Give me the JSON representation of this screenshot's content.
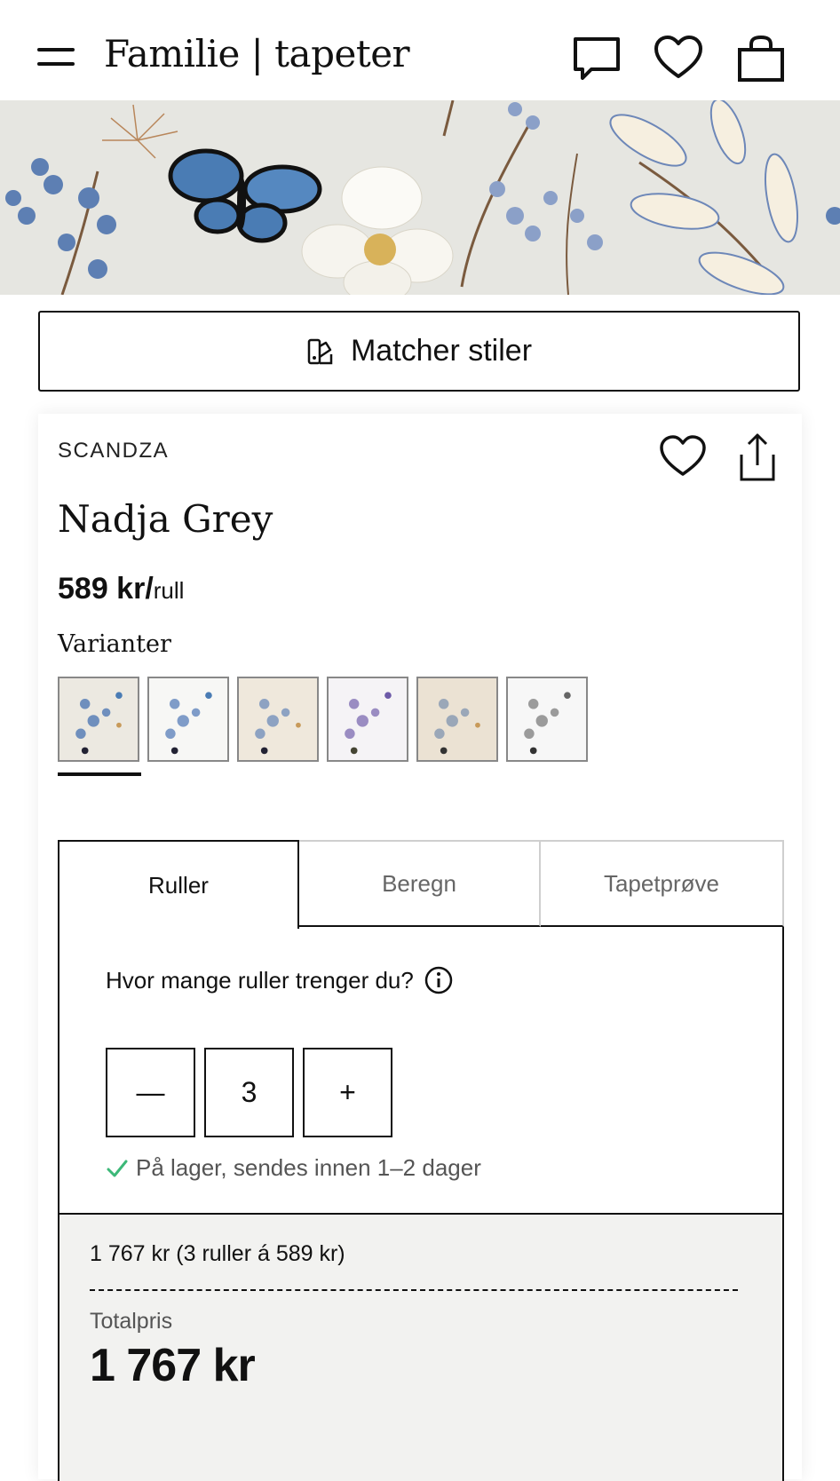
{
  "header": {
    "logo": "Familie | tapeter",
    "icons": [
      "menu-icon",
      "chat-icon",
      "heart-icon",
      "bag-icon"
    ]
  },
  "match_button": {
    "label": "Matcher stiler",
    "icon": "palette-swatch-icon"
  },
  "product": {
    "brand": "SCANDZA",
    "name": "Nadja Grey",
    "price": "589 kr/",
    "price_unit": "rull",
    "variants_title": "Varianter",
    "selected_variant": 0
  },
  "tabs": [
    {
      "label": "Ruller"
    },
    {
      "label": "Beregn"
    },
    {
      "label": "Tapetprøve"
    }
  ],
  "rolls": {
    "question": "Hvor mange ruller trenger du?",
    "quantity": "3",
    "minus": "—",
    "plus": "+",
    "stock": "På lager, sendes innen 1–2 dager"
  },
  "summary": {
    "calc": "1 767 kr (3 ruller á 589 kr)",
    "total_label": "Totalpris",
    "total_value": "1 767 kr"
  },
  "colors": {
    "accent": "#111111",
    "stock_check": "#3cb878",
    "banner_bg": "#e6e6e1",
    "summary_bg": "#f2f2f0"
  }
}
